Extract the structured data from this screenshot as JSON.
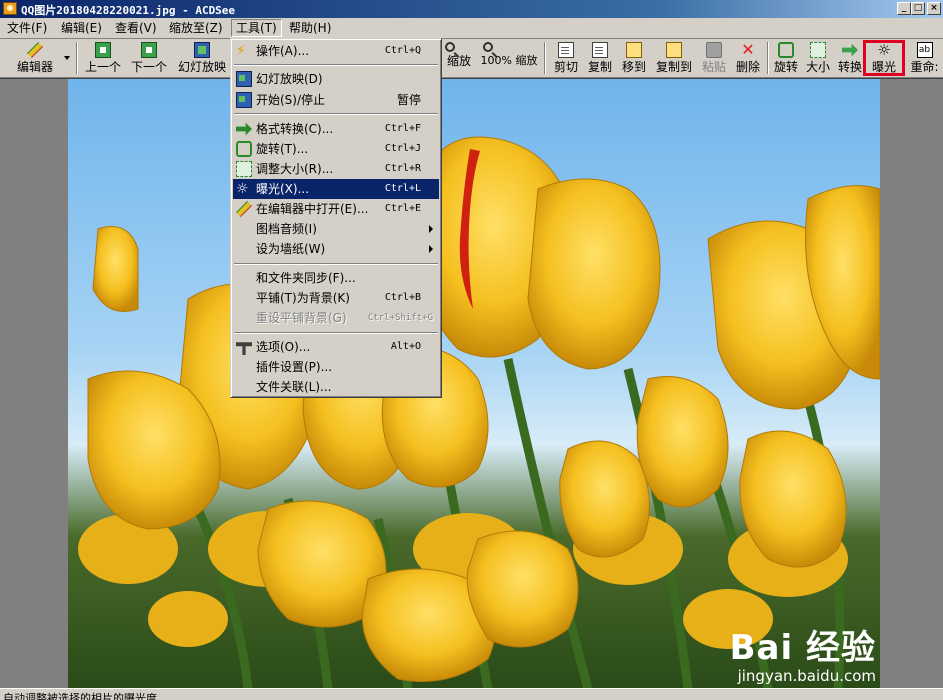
{
  "window": {
    "title": "QQ图片20180428220021.jpg - ACDSee",
    "controls": {
      "minimize": "_",
      "maximize": "□",
      "close": "×"
    }
  },
  "menubar": [
    {
      "label": "文件(F)"
    },
    {
      "label": "编辑(E)"
    },
    {
      "label": "查看(V)"
    },
    {
      "label": "缩放至(Z)"
    },
    {
      "label": "工具(T)",
      "active": true
    },
    {
      "label": "帮助(H)"
    }
  ],
  "toolbar": {
    "editor": "编辑器",
    "prev": "上一个",
    "next": "下一个",
    "slideshow": "幻灯放映",
    "zoom_partial": "缩放",
    "zoom100": "100% 缩放",
    "cut": "剪切",
    "copy": "复制",
    "move_to": "移到",
    "copy_to": "复制到",
    "paste": "粘贴",
    "delete": "删除",
    "rotate": "旋转",
    "resize": "大小",
    "convert": "转换",
    "exposure": "曝光",
    "rename": "重命:"
  },
  "tools_menu": {
    "items": [
      {
        "label": "操作(A)...",
        "shortcut": "Ctrl+Q",
        "icon": "lightning-icon"
      },
      {
        "separator": true
      },
      {
        "label": "幻灯放映(D)",
        "shortcut": "",
        "icon": "slideshow-icon"
      },
      {
        "label": "开始(S)/停止",
        "shortcut": "暂停",
        "icon": "start-stop-icon"
      },
      {
        "separator": true
      },
      {
        "label": "格式转换(C)...",
        "shortcut": "Ctrl+F",
        "icon": "convert-icon"
      },
      {
        "label": "旋转(T)...",
        "shortcut": "Ctrl+J",
        "icon": "rotate-icon"
      },
      {
        "label": "调整大小(R)...",
        "shortcut": "Ctrl+R",
        "icon": "resize-icon"
      },
      {
        "label": "曝光(X)...",
        "shortcut": "Ctrl+L",
        "icon": "exposure-icon",
        "selected": true
      },
      {
        "label": "在编辑器中打开(E)...",
        "shortcut": "Ctrl+E",
        "icon": "editor-icon"
      },
      {
        "label": "图档音频(I)",
        "submenu": true
      },
      {
        "label": "设为墙纸(W)",
        "submenu": true
      },
      {
        "separator": true
      },
      {
        "label": "和文件夹同步(F)..."
      },
      {
        "label": "平铺(T)为背景(K)",
        "shortcut": "Ctrl+B"
      },
      {
        "label": "重设平铺背景(G)",
        "shortcut": "Ctrl+Shift+G",
        "disabled": true
      },
      {
        "separator": true
      },
      {
        "label": "选项(O)...",
        "shortcut": "Alt+O",
        "icon": "options-icon"
      },
      {
        "label": "插件设置(P)..."
      },
      {
        "label": "文件关联(L)..."
      }
    ]
  },
  "status": {
    "text": "自动调整被选择的相片的曝光度"
  },
  "watermark": {
    "logo": "Bai 经验",
    "url": "jingyan.baidu.com"
  },
  "colors": {
    "menu_highlight": "#0a246a",
    "callout": "#e00020",
    "chrome": "#d4d0c8"
  }
}
